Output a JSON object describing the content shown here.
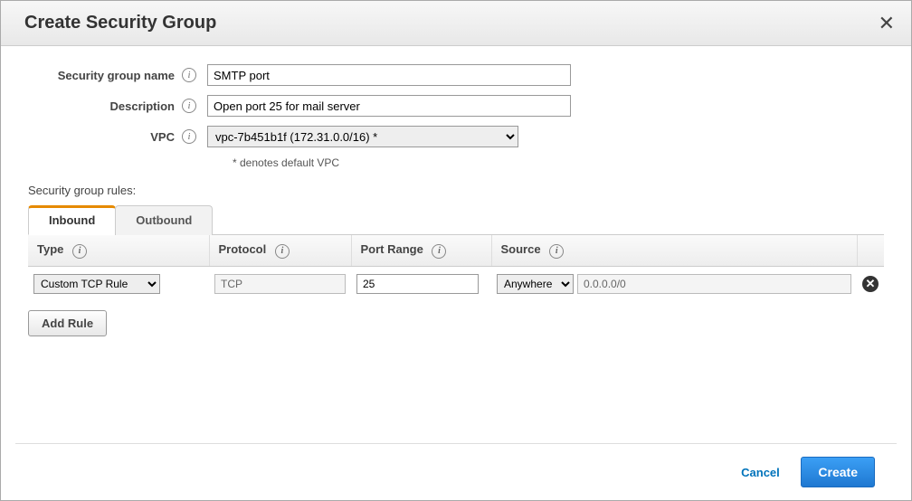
{
  "dialog": {
    "title": "Create Security Group"
  },
  "form": {
    "name_label": "Security group name",
    "name_value": "SMTP port",
    "description_label": "Description",
    "description_value": "Open port 25 for mail server",
    "vpc_label": "VPC",
    "vpc_selected": "vpc-7b451b1f (172.31.0.0/16) *",
    "vpc_hint": "* denotes default VPC"
  },
  "rules": {
    "section_label": "Security group rules:",
    "tabs": {
      "inbound": "Inbound",
      "outbound": "Outbound"
    },
    "headers": {
      "type": "Type",
      "protocol": "Protocol",
      "port_range": "Port Range",
      "source": "Source"
    },
    "rows": [
      {
        "type": "Custom TCP Rule",
        "protocol": "TCP",
        "port_range": "25",
        "source_mode": "Anywhere",
        "source_value": "0.0.0.0/0"
      }
    ],
    "add_rule_label": "Add Rule"
  },
  "footer": {
    "cancel": "Cancel",
    "create": "Create"
  }
}
